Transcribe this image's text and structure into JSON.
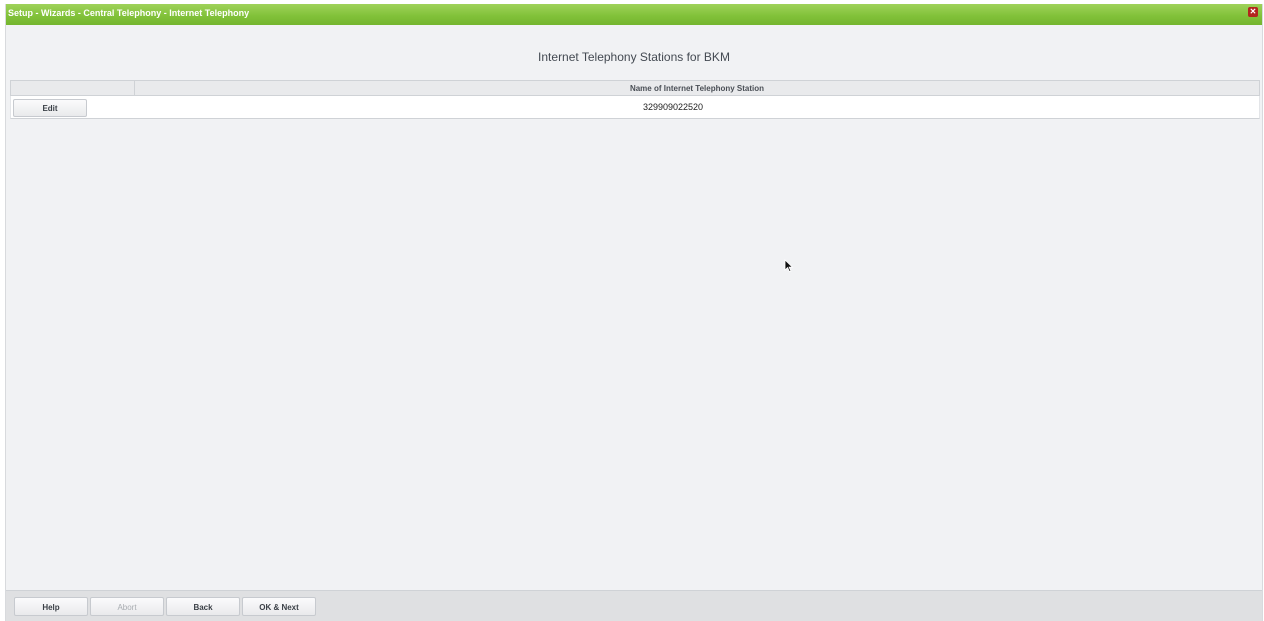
{
  "window": {
    "title": "Setup - Wizards - Central Telephony - Internet Telephony",
    "close_icon": "close-icon"
  },
  "main": {
    "heading": "Internet Telephony Stations for BKM",
    "table": {
      "columns": [
        "",
        "Name of Internet Telephony Station"
      ],
      "rows": [
        {
          "action_label": "Edit",
          "name": "329909022520"
        }
      ]
    }
  },
  "footer": {
    "buttons": [
      {
        "label": "Help",
        "enabled": true
      },
      {
        "label": "Abort",
        "enabled": false
      },
      {
        "label": "Back",
        "enabled": true
      },
      {
        "label": "OK & Next",
        "enabled": true
      }
    ]
  },
  "colors": {
    "titlebar_green": "#82c23a",
    "close_red": "#b3261e",
    "background": "#f1f2f4"
  }
}
